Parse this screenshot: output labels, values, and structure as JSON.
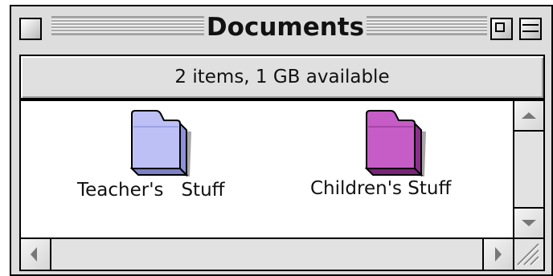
{
  "window": {
    "title": "Documents",
    "info_text": "2 items, 1 GB available"
  },
  "items": [
    {
      "label": "Teacher's   Stuff",
      "icon": "folder-icon",
      "color": "#bcc0f4",
      "shade": "#8d92d8"
    },
    {
      "label": "Children's Stuff",
      "icon": "folder-icon",
      "color": "#c65cc6",
      "shade": "#8c2e8c"
    }
  ],
  "colors": {
    "window_chrome": "#dddddd",
    "content_background": "#ffffff",
    "border": "#000000"
  }
}
